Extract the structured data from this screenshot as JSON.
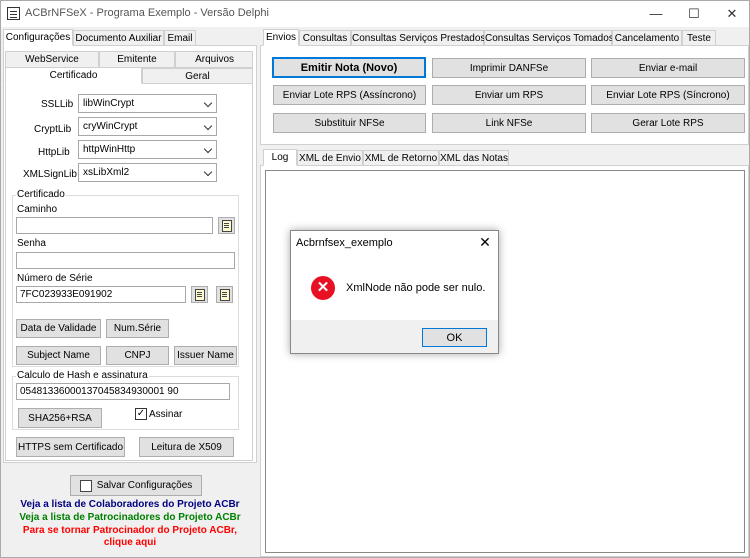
{
  "window": {
    "title": "ACBrNFSeX - Programa Exemplo - Versão Delphi"
  },
  "left_tabs": [
    "Configurações",
    "Documento Auxiliar",
    "Email"
  ],
  "sub_tabs_row1": [
    "WebService",
    "Emitente",
    "Arquivos"
  ],
  "sub_tabs_row2": [
    "Certificado",
    "Geral"
  ],
  "libs": {
    "ssl_label": "SSLLib",
    "ssl_value": "libWinCrypt",
    "crypt_label": "CryptLib",
    "crypt_value": "cryWinCrypt",
    "http_label": "HttpLib",
    "http_value": "httpWinHttp",
    "xmlsign_label": "XMLSignLib",
    "xmlsign_value": "xsLibXml2"
  },
  "cert": {
    "group_label": "Certificado",
    "caminho_label": "Caminho",
    "caminho_value": "",
    "senha_label": "Senha",
    "senha_value": "",
    "serie_label": "Número de Série",
    "serie_value": "7FC023933E091902",
    "btn_validade": "Data de Validade",
    "btn_numserie": "Num.Série",
    "btn_subject": "Subject Name",
    "btn_cnpj": "CNPJ",
    "btn_issuer": "Issuer Name"
  },
  "hash": {
    "group_label": "Calculo de Hash e assinatura",
    "value": "05481336000137045834930001 90",
    "btn_sha": "SHA256+RSA",
    "chk_assinar": "Assinar",
    "chk_checked": true
  },
  "bottom_buttons": {
    "https": "HTTPS sem Certificado",
    "leitura": "Leitura de X509"
  },
  "salvar": "Salvar Configurações",
  "links": {
    "colaboradores": "Veja a lista de Colaboradores do Projeto ACBr",
    "patrocinadores": "Veja a lista de Patrocinadores do Projeto ACBr",
    "tornar": "Para se tornar Patrocinador do Projeto ACBr,",
    "clique": "clique aqui"
  },
  "link_colors": {
    "colaboradores": "#000080",
    "patrocinadores": "#008000",
    "tornar": "#ff0000"
  },
  "right_tabs": [
    "Envios",
    "Consultas",
    "Consultas Serviços Prestados",
    "Consultas Serviços Tomados",
    "Cancelamento",
    "Teste"
  ],
  "actions": {
    "emitir": "Emitir Nota (Novo)",
    "imprimir": "Imprimir DANFSe",
    "enviar_email": "Enviar e-mail",
    "lote_assinc": "Enviar Lote RPS (Assíncrono)",
    "enviar_rps": "Enviar um RPS",
    "lote_sinc": "Enviar Lote RPS (Síncrono)",
    "substituir": "Substituir NFSe",
    "link_nfse": "Link NFSe",
    "gerar_lote": "Gerar Lote RPS"
  },
  "log_tabs": [
    "Log",
    "XML de Envio",
    "XML de Retorno",
    "XML das Notas"
  ],
  "dialog": {
    "title": "Acbrnfsex_exemplo",
    "message": "XmlNode não pode ser nulo.",
    "ok": "OK",
    "icon": "error-icon"
  },
  "colors": {
    "accent": "#0078d7",
    "error": "#e81123"
  },
  "window_controls": {
    "minimize": "—",
    "maximize": "☐",
    "close": "✕"
  }
}
